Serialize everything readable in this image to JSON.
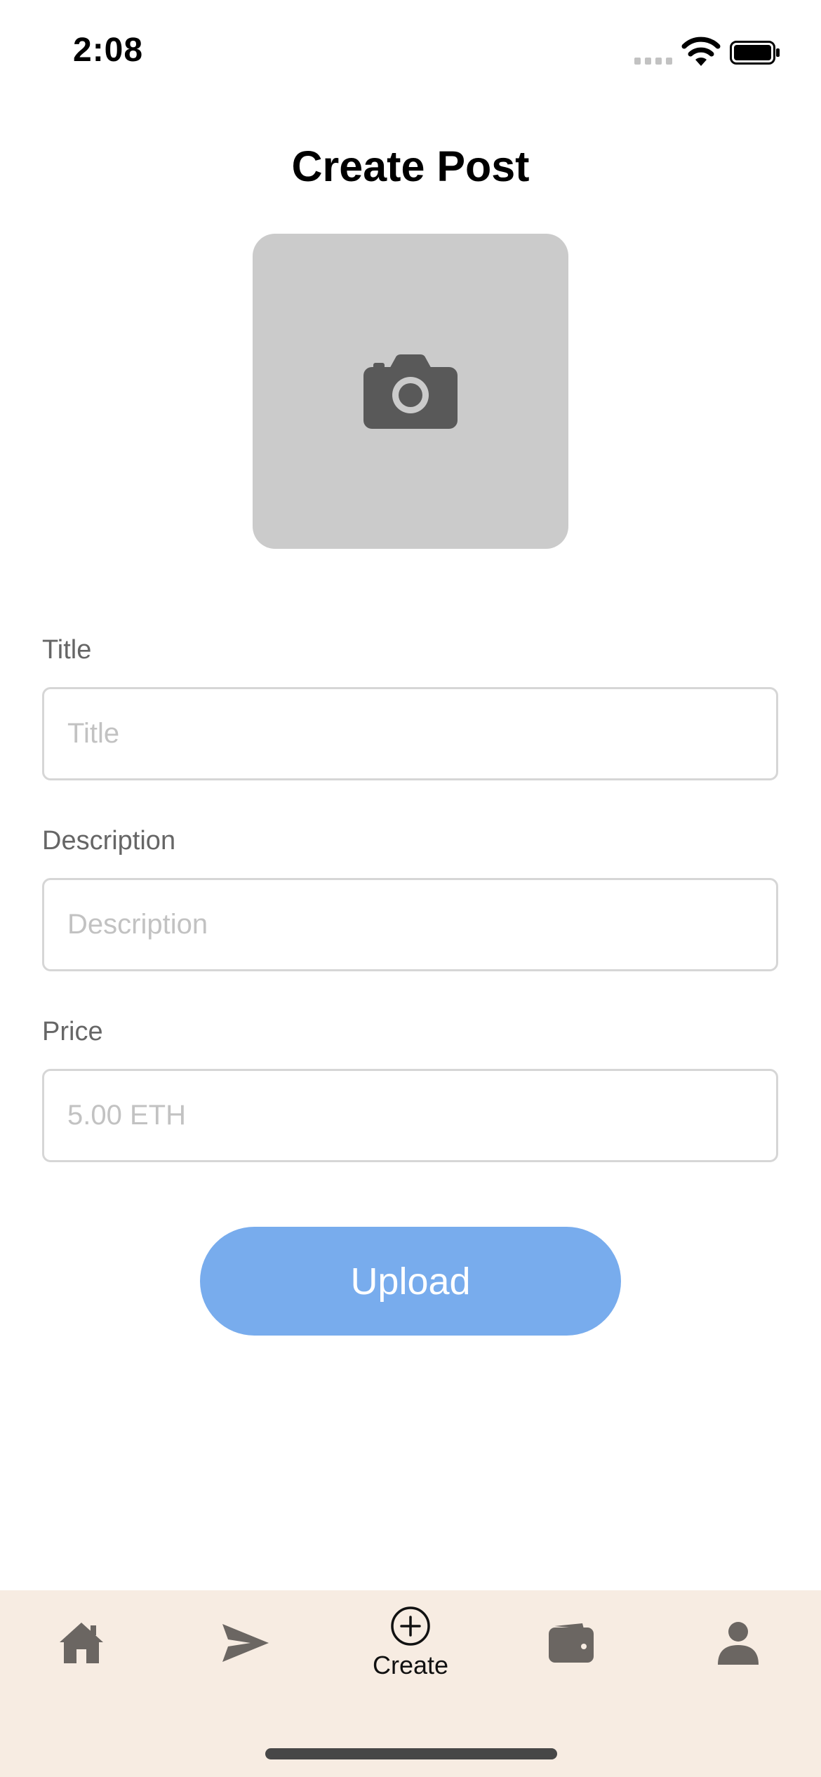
{
  "status_bar": {
    "time": "2:08",
    "icons": [
      "cellular-signal-icon",
      "wifi-icon",
      "battery-icon"
    ]
  },
  "page": {
    "title": "Create Post"
  },
  "image_picker": {
    "icon": "camera-icon",
    "background_color": "#cbcbcb"
  },
  "form": {
    "title": {
      "label": "Title",
      "value": "",
      "placeholder": "Title"
    },
    "description": {
      "label": "Description",
      "value": "",
      "placeholder": "Description"
    },
    "price": {
      "label": "Price",
      "value": "",
      "placeholder": "5.00 ETH"
    }
  },
  "upload_button": {
    "label": "Upload",
    "color": "#78aced"
  },
  "tab_bar": {
    "background_color": "#f7ece2",
    "items": [
      {
        "icon": "home-icon",
        "label": ""
      },
      {
        "icon": "send-icon",
        "label": ""
      },
      {
        "icon": "plus-circle-icon",
        "label": "Create",
        "active": true
      },
      {
        "icon": "wallet-icon",
        "label": ""
      },
      {
        "icon": "profile-icon",
        "label": ""
      }
    ]
  }
}
